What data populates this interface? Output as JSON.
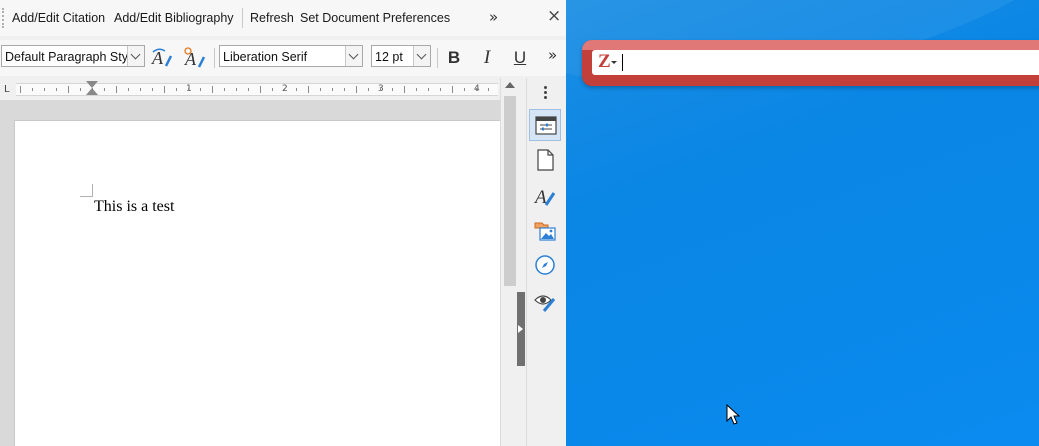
{
  "zotero_toolbar": {
    "add_edit_citation": "Add/Edit Citation",
    "add_edit_bibliography": "Add/Edit Bibliography",
    "refresh": "Refresh",
    "set_document_preferences": "Set Document Preferences",
    "overflow": "»",
    "close": "×"
  },
  "formatting": {
    "paragraph_style": "Default Paragraph Style",
    "font_name": "Liberation Serif",
    "font_size": "12 pt",
    "bold": "B",
    "italic": "I",
    "underline": "U",
    "overflow": "»"
  },
  "ruler": {
    "corner": "L",
    "numbers": [
      "1",
      "2",
      "3",
      "4"
    ]
  },
  "document": {
    "text": "This is a test"
  },
  "zotero_search": {
    "logo": "Z",
    "value": ""
  },
  "colors": {
    "desktop_blue": "#0a86e5",
    "zotero_red": "#c33f3a"
  }
}
